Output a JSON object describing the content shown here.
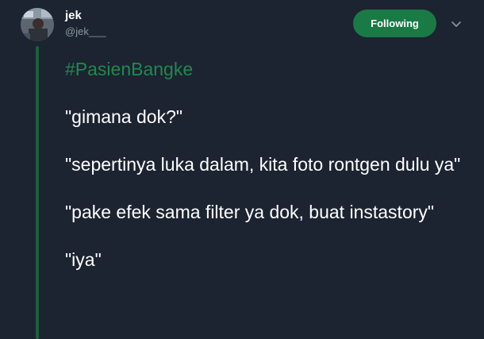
{
  "user": {
    "display_name": "jek",
    "handle": "@jek___"
  },
  "follow_button": {
    "label": "Following"
  },
  "menu": {
    "icon": "chevron-down-icon"
  },
  "tweet": {
    "hashtag": "#PasienBangke",
    "lines": [
      "\"gimana dok?\"",
      "\"sepertinya luka dalam, kita foto rontgen dulu ya\"",
      "\"pake efek sama filter ya dok, buat instastory\"",
      "\"iya\""
    ]
  },
  "colors": {
    "background": "#1c2331",
    "accent": "#1a7a46",
    "hashtag": "#1f8a4c",
    "thread_line": "#1e5f3c",
    "muted_text": "#8899a6"
  }
}
